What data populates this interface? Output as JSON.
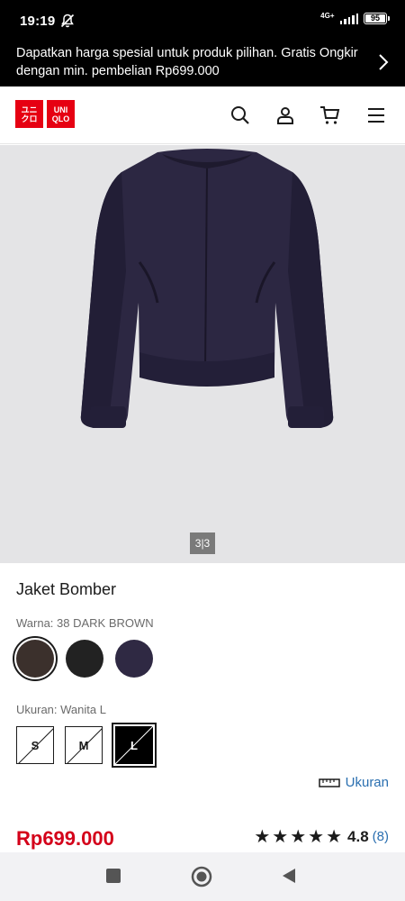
{
  "status_bar": {
    "time": "19:19",
    "network": "4G+",
    "battery": "95"
  },
  "promo": {
    "text": "Dapatkan harga spesial untuk produk pilihan. Gratis Ongkir dengan min. pembelian Rp699.000"
  },
  "header": {
    "logo_top": "ユニ",
    "logo_top2": "UNI",
    "logo_bottom": "クロ",
    "logo_bottom2": "QLO"
  },
  "gallery": {
    "pager": "3|3"
  },
  "product": {
    "name": "Jaket Bomber",
    "color_label": "Warna: 38 DARK BROWN",
    "colors": [
      {
        "name": "dark-brown",
        "hex": "#3b302c",
        "selected": true
      },
      {
        "name": "black",
        "hex": "#222222",
        "selected": false
      },
      {
        "name": "navy",
        "hex": "#2f2943",
        "selected": false
      }
    ],
    "size_label": "Ukuran: Wanita L",
    "sizes": [
      "S",
      "M",
      "L"
    ],
    "selected_size": "L",
    "size_guide": "Ukuran",
    "price": "Rp699.000",
    "rating_stars": "★★★★★",
    "rating_value": "4.8",
    "rating_count": "(8)"
  },
  "colors": {
    "brand_red": "#e60012",
    "price_red": "#d4001a",
    "link_blue": "#2a6fb0"
  }
}
